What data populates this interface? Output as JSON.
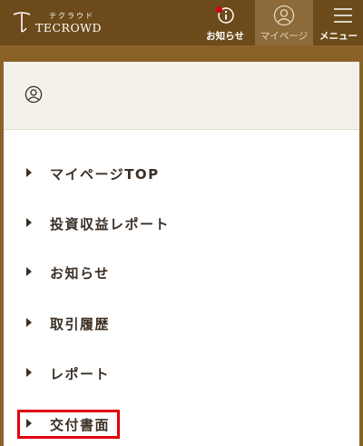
{
  "header": {
    "logo": {
      "kana": "テクラウド",
      "wordmark": "TECROWD",
      "icon": "tecrowd-logo-mark"
    },
    "buttons": {
      "notice": {
        "label": "お知らせ",
        "icon": "info-icon",
        "has_unread_dot": true,
        "dot_color": "#d1001c"
      },
      "mypage": {
        "label": "マイページ",
        "icon": "user-icon",
        "active": true
      },
      "menu": {
        "label": "メニュー",
        "icon": "hamburger-icon"
      }
    },
    "colors": {
      "bar": "#6c4a1a",
      "active_tab": "#8c6a3a"
    }
  },
  "panel": {
    "head_icon": "user-icon",
    "items": [
      {
        "label": "マイページTOP"
      },
      {
        "label": "投資収益レポート"
      },
      {
        "label": "お知らせ"
      },
      {
        "label": "取引履歴"
      },
      {
        "label": "レポート"
      },
      {
        "label": "交付書面",
        "highlighted": true
      }
    ],
    "highlight_color": "#e00010"
  },
  "colors": {
    "page_background": "#8a6228",
    "text": "#3b2f24"
  }
}
